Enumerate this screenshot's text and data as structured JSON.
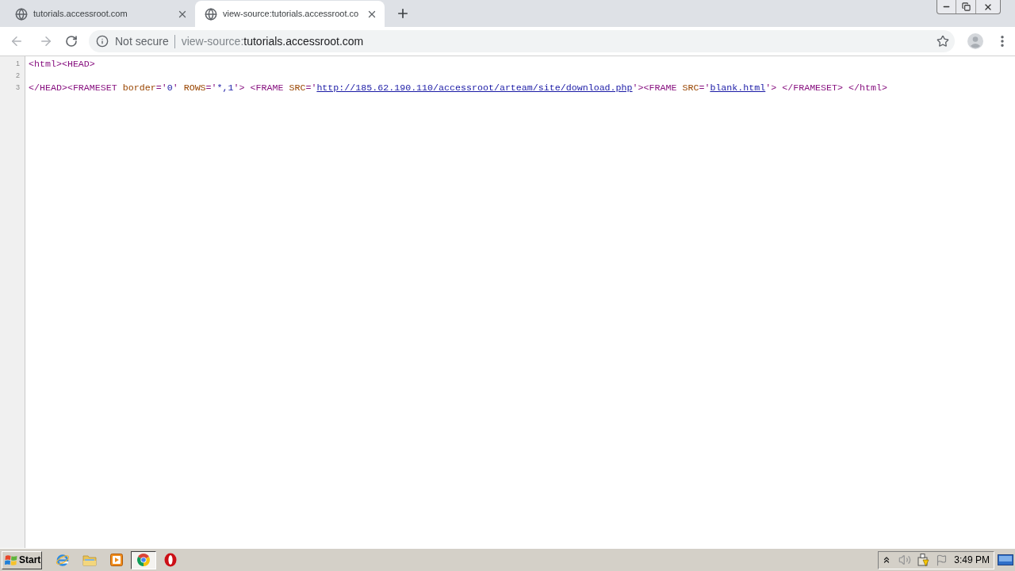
{
  "tabs": [
    {
      "title": "tutorials.accessroot.com",
      "selected": false
    },
    {
      "title": "view-source:tutorials.accessroot.co",
      "selected": true
    }
  ],
  "address_bar": {
    "security_label": "Not secure",
    "scheme": "view-source:",
    "host": "tutorials.accessroot.com"
  },
  "source": {
    "lines": [
      {
        "number": "1",
        "tokens": [
          {
            "kind": "tag",
            "text": "<html><HEAD>"
          }
        ]
      },
      {
        "number": "2"
      },
      {
        "number": "3",
        "tokens": [
          {
            "kind": "tag",
            "text": "</HEAD><FRAMESET "
          },
          {
            "kind": "attribute",
            "text": "border"
          },
          {
            "kind": "tag",
            "text": "='"
          },
          {
            "kind": "value",
            "text": "0"
          },
          {
            "kind": "tag",
            "text": "' "
          },
          {
            "kind": "attribute",
            "text": "ROWS"
          },
          {
            "kind": "tag",
            "text": "='"
          },
          {
            "kind": "value",
            "text": "*,1"
          },
          {
            "kind": "tag",
            "text": "'> <FRAME "
          },
          {
            "kind": "attribute",
            "text": "SRC"
          },
          {
            "kind": "tag",
            "text": "='"
          },
          {
            "kind": "link",
            "text": "http://185.62.190.110/accessroot/arteam/site/download.php"
          },
          {
            "kind": "tag",
            "text": "'><FRAME "
          },
          {
            "kind": "attribute",
            "text": "SRC"
          },
          {
            "kind": "tag",
            "text": "='"
          },
          {
            "kind": "link",
            "text": "blank.html"
          },
          {
            "kind": "tag",
            "text": "'> </FRAMESET> </html>"
          }
        ]
      }
    ]
  },
  "taskbar": {
    "start_label": "Start",
    "apps": [
      {
        "selected": false
      },
      {
        "selected": false
      },
      {
        "selected": false
      },
      {
        "selected": true
      },
      {
        "selected": false
      }
    ],
    "clock": "3:49 PM"
  }
}
